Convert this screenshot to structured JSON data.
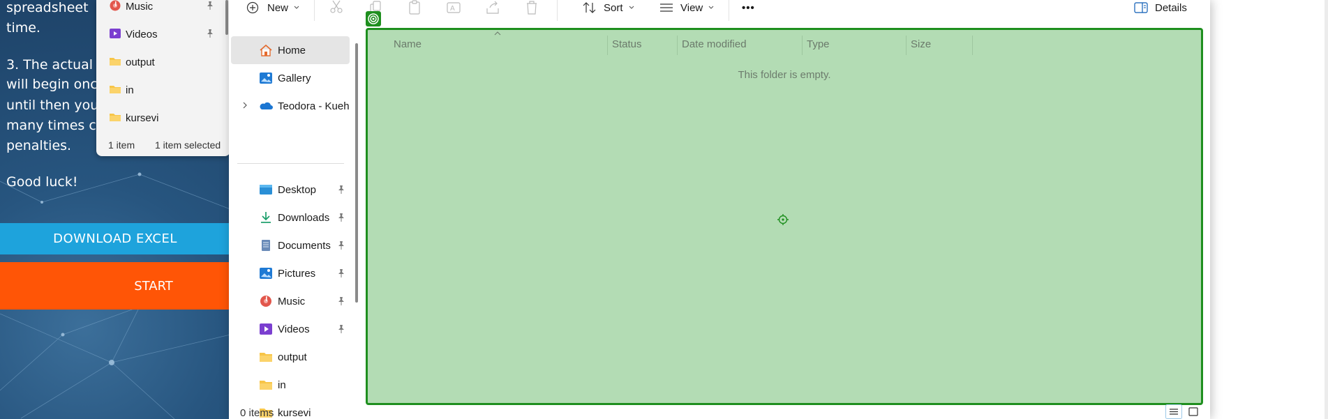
{
  "webpage": {
    "text_lines": [
      "spreadsheet",
      "time.",
      "",
      "3. The actual",
      "will begin onc",
      "until then you",
      "many times c",
      "penalties.",
      "",
      "Good luck!"
    ],
    "download_button": "DOWNLOAD EXCEL",
    "start_button": "START"
  },
  "bg_explorer": {
    "items": [
      {
        "label": "Music",
        "icon": "music-icon",
        "pinned": true
      },
      {
        "label": "Videos",
        "icon": "videos-icon",
        "pinned": true
      },
      {
        "label": "output",
        "icon": "folder-icon",
        "pinned": false
      },
      {
        "label": "in",
        "icon": "folder-icon",
        "pinned": false
      },
      {
        "label": "kursevi",
        "icon": "folder-icon",
        "pinned": false
      }
    ],
    "status_count": "1 item",
    "status_selected": "1 item selected"
  },
  "toolbar": {
    "new_label": "New",
    "sort_label": "Sort",
    "view_label": "View",
    "more_label": "•••",
    "details_label": "Details"
  },
  "nav": {
    "home": "Home",
    "gallery": "Gallery",
    "onedrive": "Teodora - Kuehne",
    "items": [
      {
        "label": "Desktop",
        "icon": "desktop-icon",
        "pinned": true
      },
      {
        "label": "Downloads",
        "icon": "downloads-icon",
        "pinned": true
      },
      {
        "label": "Documents",
        "icon": "documents-icon",
        "pinned": true
      },
      {
        "label": "Pictures",
        "icon": "pictures-icon",
        "pinned": true
      },
      {
        "label": "Music",
        "icon": "music-icon",
        "pinned": true
      },
      {
        "label": "Videos",
        "icon": "videos-icon",
        "pinned": true
      },
      {
        "label": "output",
        "icon": "folder-icon",
        "pinned": false
      },
      {
        "label": "in",
        "icon": "folder-icon",
        "pinned": false
      },
      {
        "label": "kursevi",
        "icon": "folder-icon",
        "pinned": false
      }
    ]
  },
  "columns": {
    "name": "Name",
    "status": "Status",
    "date_modified": "Date modified",
    "type": "Type",
    "size": "Size"
  },
  "content": {
    "empty_message": "This folder is empty."
  },
  "status_bar": {
    "count": "0 items"
  },
  "colors": {
    "highlight_fill": "#b3dcb4",
    "highlight_border": "#1e8f1e",
    "download_button": "#1ea3dc",
    "start_button": "#ff5506",
    "folder": "#f7c548"
  }
}
